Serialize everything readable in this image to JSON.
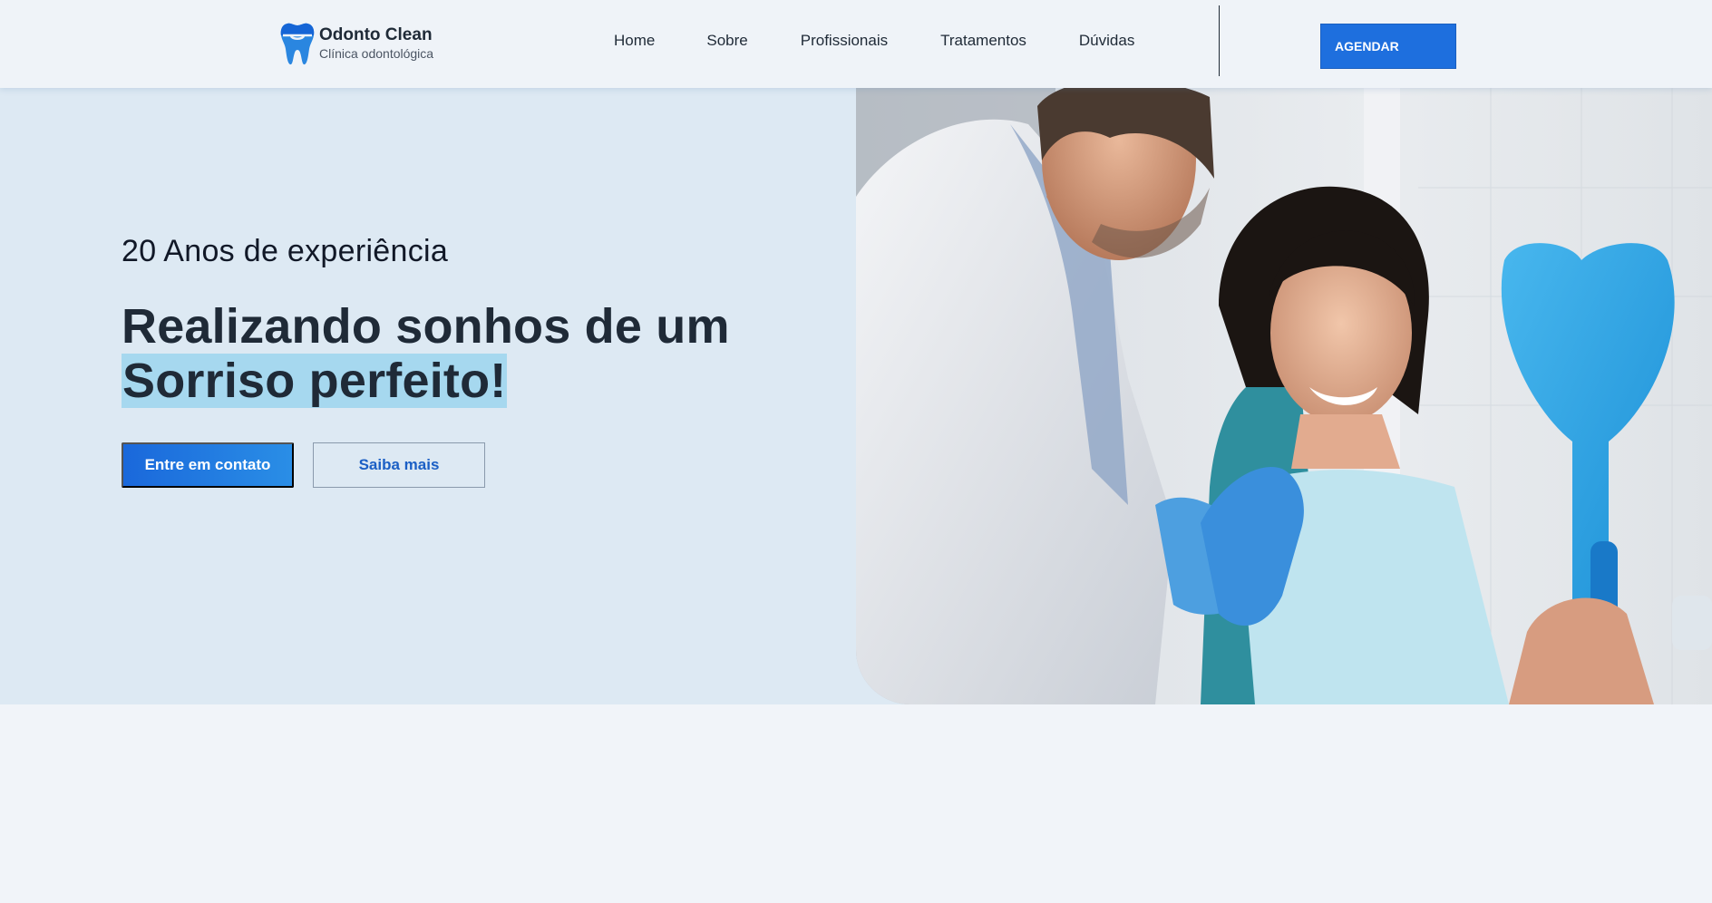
{
  "brand": {
    "title": "Odonto Clean",
    "subtitle": "Clínica odontológica",
    "color": "#1e6fde"
  },
  "nav": {
    "items": [
      "Home",
      "Sobre",
      "Profissionais",
      "Tratamentos",
      "Dúvidas"
    ]
  },
  "header": {
    "cta_label": "AGENDAR"
  },
  "hero": {
    "kicker": "20 Anos de experiência",
    "headline_line1": "Realizando sonhos de um",
    "headline_line2": "Sorriso perfeito!",
    "primary_button": "Entre em contato",
    "secondary_button": "Saiba mais",
    "highlight_color": "#a6d8ef",
    "background_color": "#dde9f3"
  },
  "image": {
    "icon": "dentist-patient-photo"
  }
}
